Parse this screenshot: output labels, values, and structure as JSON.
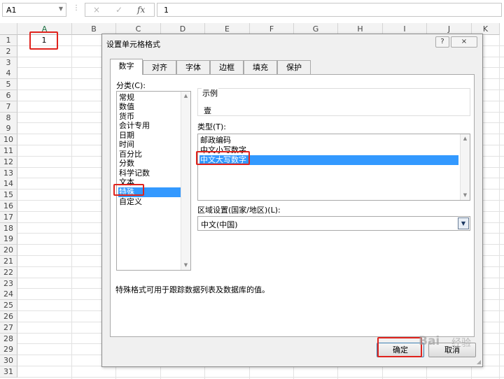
{
  "formula_bar": {
    "name_box": "A1",
    "name_box_arrow_icon": "chevron-down-icon",
    "separator": "⋮",
    "cancel_icon": "×",
    "enter_icon": "✓",
    "fx_label": "fx",
    "formula_value": "1"
  },
  "sheet": {
    "columns": [
      "A",
      "B",
      "C",
      "D",
      "E",
      "F",
      "G",
      "H",
      "I",
      "J",
      "K"
    ],
    "rows": [
      "1",
      "2",
      "3",
      "4",
      "5",
      "6",
      "7",
      "8",
      "9",
      "10",
      "11",
      "12",
      "13",
      "14",
      "15",
      "16",
      "17",
      "18",
      "19",
      "20",
      "21",
      "22",
      "23",
      "24",
      "25",
      "26",
      "27",
      "28",
      "29",
      "30",
      "31"
    ],
    "active_cell": "A1",
    "a1_value": "1",
    "highlight_color": "#e0231d"
  },
  "dialog": {
    "title": "设置单元格格式",
    "help_button": "?",
    "close_button": "×",
    "tabs": [
      "数字",
      "对齐",
      "字体",
      "边框",
      "填充",
      "保护"
    ],
    "active_tab": "数字",
    "category_label": "分类(C):",
    "categories": [
      "常规",
      "数值",
      "货币",
      "会计专用",
      "日期",
      "时间",
      "百分比",
      "分数",
      "科学记数",
      "文本",
      "特殊",
      "自定义"
    ],
    "selected_category": "特殊",
    "sample_label": "示例",
    "sample_value": "壹",
    "type_label": "类型(T):",
    "types": [
      "邮政编码",
      "中文小写数字",
      "中文大写数字"
    ],
    "selected_type": "中文大写数字",
    "locale_label": "区域设置(国家/地区)(L):",
    "locale_value": "中文(中国)",
    "description": "特殊格式可用于跟踪数据列表及数据库的值。",
    "ok_button": "确定",
    "cancel_button": "取消",
    "selection_color": "#3399ff"
  },
  "watermark": {
    "text": "Bai",
    "text2": "经验"
  }
}
